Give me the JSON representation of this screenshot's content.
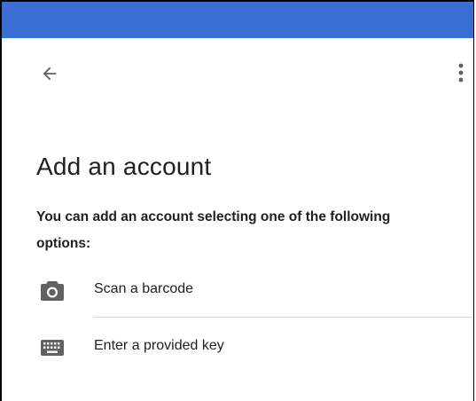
{
  "colors": {
    "status_bar": "#3c6fd6",
    "text": "#212121",
    "icon": "#616161",
    "divider": "#d6d6d6"
  },
  "toolbar": {
    "back_icon": "arrow-back-icon",
    "menu_icon": "more-vert-icon"
  },
  "page": {
    "title": "Add an account",
    "description": "You can add an account selecting one of the following options:"
  },
  "options": [
    {
      "label": "Scan a barcode",
      "icon": "camera-icon"
    },
    {
      "label": "Enter a provided key",
      "icon": "keyboard-icon"
    }
  ]
}
